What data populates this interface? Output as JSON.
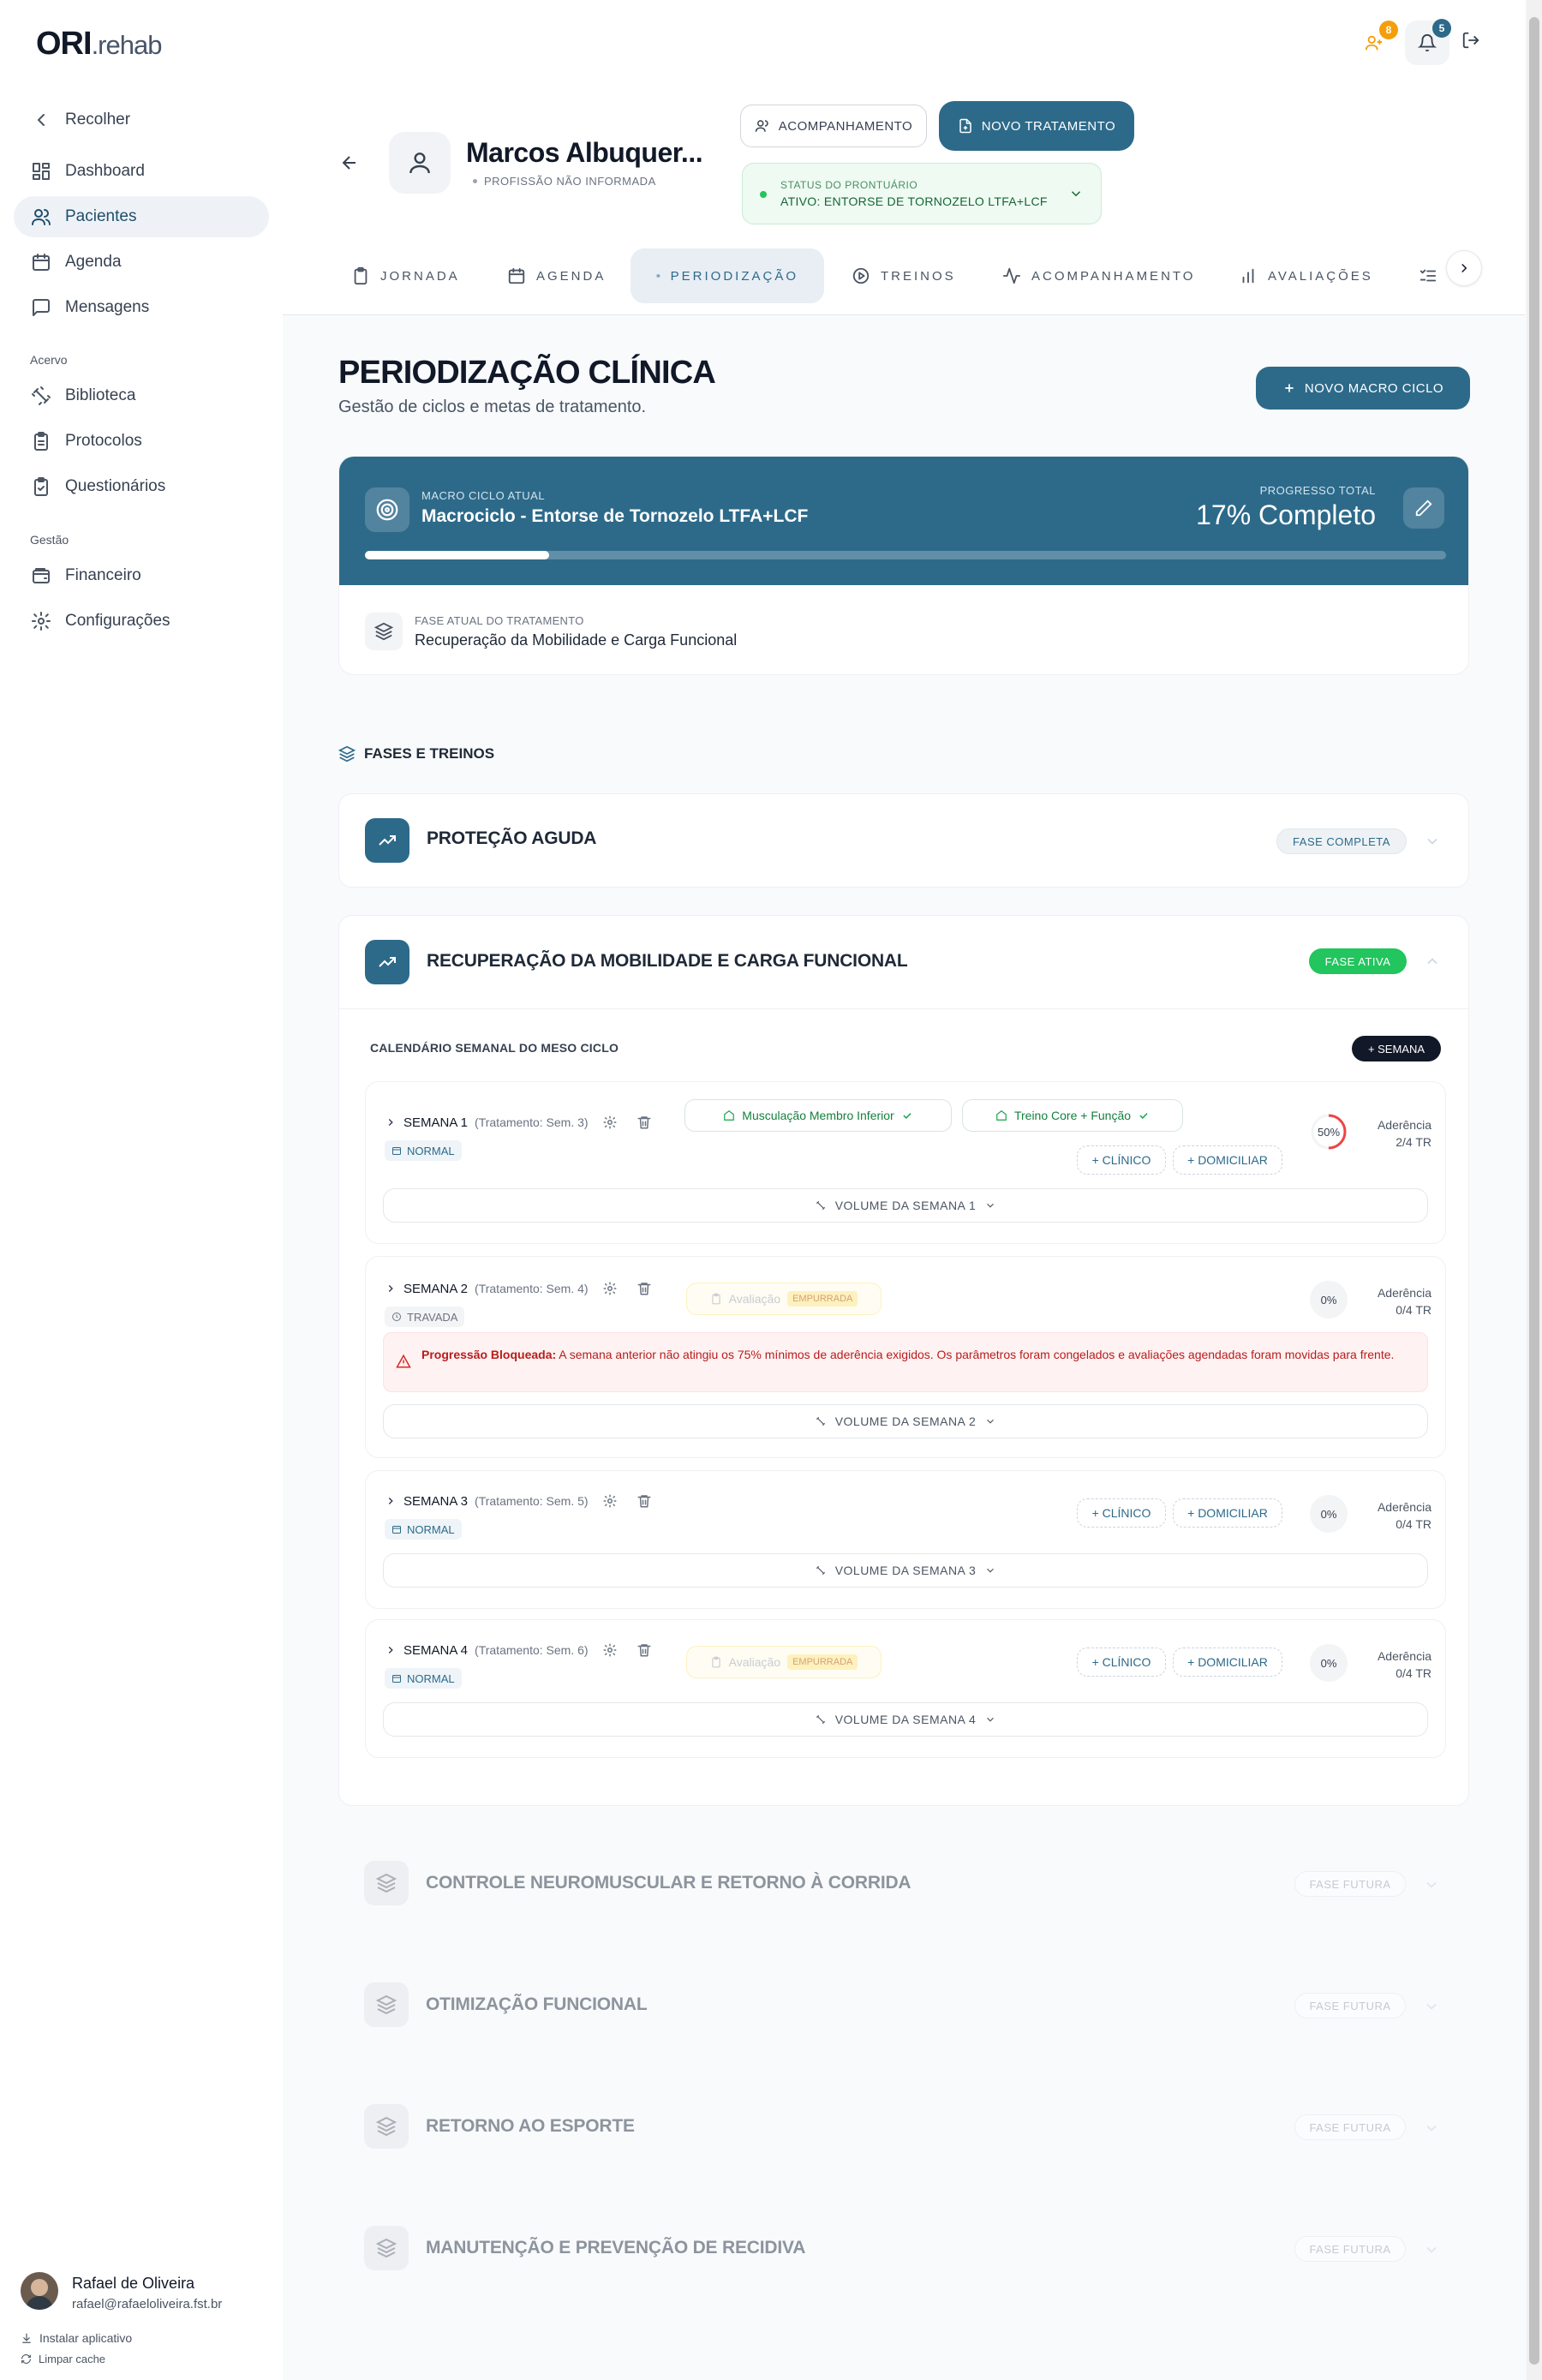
{
  "app": {
    "logo_bold": "ORI",
    "logo_rest": ".rehab"
  },
  "sidebar": {
    "collapse": "Recolher",
    "items": [
      {
        "label": "Dashboard"
      },
      {
        "label": "Pacientes"
      },
      {
        "label": "Agenda"
      },
      {
        "label": "Mensagens"
      }
    ],
    "section_acervo": "Acervo",
    "acervo": [
      {
        "label": "Biblioteca"
      },
      {
        "label": "Protocolos"
      },
      {
        "label": "Questionários"
      }
    ],
    "section_gestao": "Gestão",
    "gestao": [
      {
        "label": "Financeiro"
      },
      {
        "label": "Configurações"
      }
    ],
    "user": {
      "name": "Rafael de Oliveira",
      "email": "rafael@rafaeloliveira.fst.br"
    },
    "install": "Instalar aplicativo",
    "clear_cache": "Limpar cache"
  },
  "topbar": {
    "users_badge": "8",
    "bell_badge": "5"
  },
  "patient": {
    "name": "Marcos Albuquer...",
    "profession": "PROFISSÃO NÃO INFORMADA",
    "btn_follow": "ACOMPANHAMENTO",
    "btn_new_treatment": "NOVO TRATAMENTO",
    "status_label": "STATUS DO PRONTUÁRIO",
    "status_value": "ATIVO: ENTORSE DE TORNOZELO LTFA+LCF"
  },
  "tabs": [
    {
      "label": "JORNADA"
    },
    {
      "label": "AGENDA"
    },
    {
      "label": "PERIODIZAÇÃO"
    },
    {
      "label": "TREINOS"
    },
    {
      "label": "ACOMPANHAMENTO"
    },
    {
      "label": "AVALIAÇÕES"
    }
  ],
  "page": {
    "title": "PERIODIZAÇÃO CLÍNICA",
    "subtitle": "Gestão de ciclos e metas de tratamento.",
    "new_macro": "NOVO MACRO CICLO"
  },
  "macro": {
    "label": "MACRO CICLO ATUAL",
    "name": "Macrociclo - Entorse de Tornozelo LTFA+LCF",
    "progress_label": "PROGRESSO TOTAL",
    "progress_text": "17% Completo",
    "progress": 0.17,
    "phase_label": "FASE ATUAL DO TRATAMENTO",
    "phase_value": "Recuperação da Mobilidade e Carga Funcional"
  },
  "phases_heading": "FASES E TREINOS",
  "phases": [
    {
      "title": "PROTEÇÃO AGUDA",
      "badge": "FASE COMPLETA"
    },
    {
      "title": "RECUPERAÇÃO DA MOBILIDADE E CARGA FUNCIONAL",
      "badge": "FASE ATIVA"
    },
    {
      "title": "CONTROLE NEUROMUSCULAR E RETORNO À CORRIDA",
      "badge": "FASE FUTURA"
    },
    {
      "title": "OTIMIZAÇÃO FUNCIONAL",
      "badge": "FASE FUTURA"
    },
    {
      "title": "RETORNO AO ESPORTE",
      "badge": "FASE FUTURA"
    },
    {
      "title": "MANUTENÇÃO E PREVENÇÃO DE RECIDIVA",
      "badge": "FASE FUTURA"
    }
  ],
  "calendar": {
    "heading": "CALENDÁRIO SEMANAL DO MESO CICLO",
    "add_week": "+ SEMANA",
    "adherence": "Aderência",
    "clinic": "+ CLÍNICO",
    "home": "+ DOMICILIAR",
    "weeks": [
      {
        "title": "SEMANA 1",
        "sub": "(Tratamento: Sem. 3)",
        "tag": "NORMAL",
        "pct": "50%",
        "adherence": 0.5,
        "count": "2/4 TR",
        "volume": "VOLUME DA SEMANA 1",
        "trainings": [
          {
            "label": "Musculação Membro Inferior"
          },
          {
            "label": "Treino Core + Função"
          }
        ]
      },
      {
        "title": "SEMANA 2",
        "sub": "(Tratamento: Sem. 4)",
        "tag": "TRAVADA",
        "pct": "0%",
        "adherence": 0,
        "count": "0/4 TR",
        "volume": "VOLUME DA SEMANA 2",
        "eval": "Avaliação",
        "eval_tag": "EMPURRADA",
        "alert_bold": "Progressão Bloqueada:",
        "alert_text": "A semana anterior não atingiu os 75% mínimos de aderência exigidos. Os parâmetros foram congelados e avaliações agendadas foram movidas para frente."
      },
      {
        "title": "SEMANA 3",
        "sub": "(Tratamento: Sem. 5)",
        "tag": "NORMAL",
        "pct": "0%",
        "adherence": 0,
        "count": "0/4 TR",
        "volume": "VOLUME DA SEMANA 3"
      },
      {
        "title": "SEMANA 4",
        "sub": "(Tratamento: Sem. 6)",
        "tag": "NORMAL",
        "pct": "0%",
        "adherence": 0,
        "count": "0/4 TR",
        "volume": "VOLUME DA SEMANA 4",
        "eval": "Avaliação",
        "eval_tag": "EMPURRADA"
      }
    ]
  },
  "colors": {
    "primary": "#2d6a8a",
    "success": "#22c55e",
    "warning": "#f59e0b",
    "danger": "#ef4444"
  }
}
